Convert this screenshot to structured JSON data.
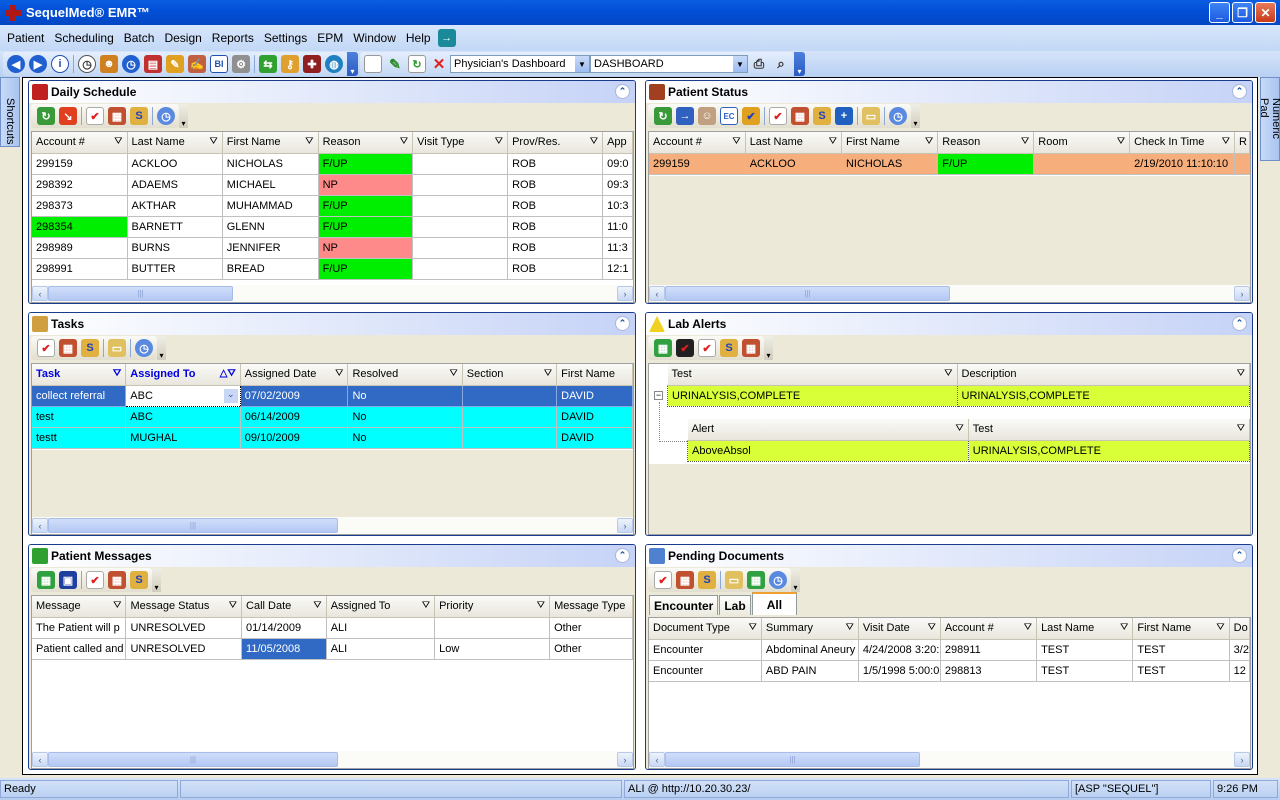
{
  "window": {
    "title": "SequelMed® EMR™",
    "controls": [
      "minimize",
      "restore",
      "close"
    ]
  },
  "menu": [
    "Patient",
    "Scheduling",
    "Batch",
    "Design",
    "Reports",
    "Settings",
    "EPM",
    "Window",
    "Help"
  ],
  "toolbar": {
    "dashboard_combo": "Physician's Dashboard",
    "view_combo": "DASHBOARD"
  },
  "side": {
    "left_label": "Shortcuts",
    "right_label": "Numeric Pad"
  },
  "daily_schedule": {
    "title": "Daily Schedule",
    "columns": [
      "Account #",
      "Last Name",
      "First Name",
      "Reason",
      "Visit Type",
      "Prov/Res.",
      "App"
    ],
    "rows": [
      {
        "account": "299159",
        "last": "ACKLOO",
        "first": "NICHOLAS",
        "reason": "F/UP",
        "visit": "",
        "prov": "ROB",
        "appt": "09:0"
      },
      {
        "account": "298392",
        "last": "ADAEMS",
        "first": "MICHAEL",
        "reason": "NP",
        "visit": "",
        "prov": "ROB",
        "appt": "09:3"
      },
      {
        "account": "298373",
        "last": "AKTHAR",
        "first": "MUHAMMAD",
        "reason": "F/UP",
        "visit": "",
        "prov": "ROB",
        "appt": "10:3"
      },
      {
        "account": "298354",
        "last": "BARNETT",
        "first": "GLENN",
        "reason": "F/UP",
        "visit": "",
        "prov": "ROB",
        "appt": "11:0"
      },
      {
        "account": "298989",
        "last": "BURNS",
        "first": "JENNIFER",
        "reason": "NP",
        "visit": "",
        "prov": "ROB",
        "appt": "11:3"
      },
      {
        "account": "298991",
        "last": "BUTTER",
        "first": "BREAD",
        "reason": "F/UP",
        "visit": "",
        "prov": "ROB",
        "appt": "12:1"
      }
    ]
  },
  "patient_status": {
    "title": "Patient Status",
    "columns": [
      "Account #",
      "Last Name",
      "First Name",
      "Reason",
      "Room",
      "Check In Time",
      "R"
    ],
    "rows": [
      {
        "account": "299159",
        "last": "ACKLOO",
        "first": "NICHOLAS",
        "reason": "F/UP",
        "room": "",
        "checkin": "2/19/2010 11:10:10"
      }
    ]
  },
  "tasks": {
    "title": "Tasks",
    "columns": [
      "Task",
      "Assigned To",
      "Assigned Date",
      "Resolved",
      "Section",
      "First Name"
    ],
    "rows": [
      {
        "task": "collect referral",
        "assigned": "ABC",
        "date": "07/02/2009",
        "resolved": "No",
        "section": "",
        "first": "DAVID"
      },
      {
        "task": "test",
        "assigned": "ABC",
        "date": "06/14/2009",
        "resolved": "No",
        "section": "",
        "first": "DAVID"
      },
      {
        "task": "testt",
        "assigned": "MUGHAL",
        "date": "09/10/2009",
        "resolved": "No",
        "section": "",
        "first": "DAVID"
      }
    ]
  },
  "lab_alerts": {
    "title": "Lab Alerts",
    "columns": [
      "Test",
      "Description"
    ],
    "row": {
      "test": "URINALYSIS,COMPLETE",
      "description": "URINALYSIS,COMPLETE"
    },
    "child_columns": [
      "Alert",
      "Test"
    ],
    "child_row": {
      "alert": "AboveAbsol",
      "test": "URINALYSIS,COMPLETE"
    }
  },
  "patient_messages": {
    "title": "Patient Messages",
    "columns": [
      "Message",
      "Message Status",
      "Call Date",
      "Assigned To",
      "Priority",
      "Message Type"
    ],
    "rows": [
      {
        "message": "The Patient will p",
        "status": "UNRESOLVED",
        "date": "01/14/2009",
        "assigned": "ALI",
        "priority": "",
        "type": "Other"
      },
      {
        "message": "Patient called and",
        "status": "UNRESOLVED",
        "date": "11/05/2008",
        "assigned": "ALI",
        "priority": "Low",
        "type": "Other"
      }
    ]
  },
  "pending_documents": {
    "title": "Pending Documents",
    "tabs": [
      "Encounter",
      "Lab",
      "All"
    ],
    "active_tab": "All",
    "columns": [
      "Document Type",
      "Summary",
      "Visit Date",
      "Account #",
      "Last Name",
      "First Name",
      "Do"
    ],
    "rows": [
      {
        "type": "Encounter",
        "summary": "Abdominal Aneury",
        "visit": "4/24/2008 3:20:",
        "account": "298911",
        "last": "TEST",
        "first": "TEST",
        "d": "3/2"
      },
      {
        "type": "Encounter",
        "summary": "ABD PAIN",
        "visit": "1/5/1998 5:00:0",
        "account": "298813",
        "last": "TEST",
        "first": "TEST",
        "d": "12"
      }
    ]
  },
  "statusbar": {
    "status": "Ready",
    "blank": "",
    "user": "ALI @ http://10.20.30.23/",
    "server": "[ASP \"SEQUEL\"]",
    "time": "9:26 PM"
  },
  "colors": {
    "followup": "#00ee00",
    "new_patient": "#ff8a8a",
    "selected": "#316ac5",
    "cyan": "#00ffff",
    "checked_in": "#f6ae7c",
    "lab_alert": "#d8ff38"
  }
}
